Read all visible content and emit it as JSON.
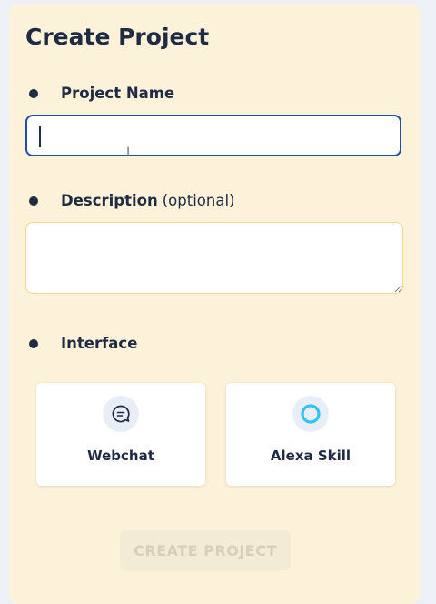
{
  "form": {
    "title": "Create Project",
    "project_name": {
      "label": "Project Name",
      "value": "",
      "placeholder": ""
    },
    "description": {
      "label": "Description",
      "optional": "(optional)",
      "value": "",
      "placeholder": ""
    },
    "interface": {
      "label": "Interface",
      "options": [
        {
          "label": "Webchat",
          "icon": "chat-bubble-icon"
        },
        {
          "label": "Alexa Skill",
          "icon": "alexa-ring-icon"
        }
      ]
    },
    "submit_label": "CREATE PROJECT"
  },
  "colors": {
    "panel_bg": "#fcf2d9",
    "page_bg": "#eef0f7",
    "text": "#1f2a44",
    "input_focus_border": "#1f4fa8",
    "alexa_blue": "#31c4f3",
    "disabled_button_text": "#d8cfb8"
  }
}
